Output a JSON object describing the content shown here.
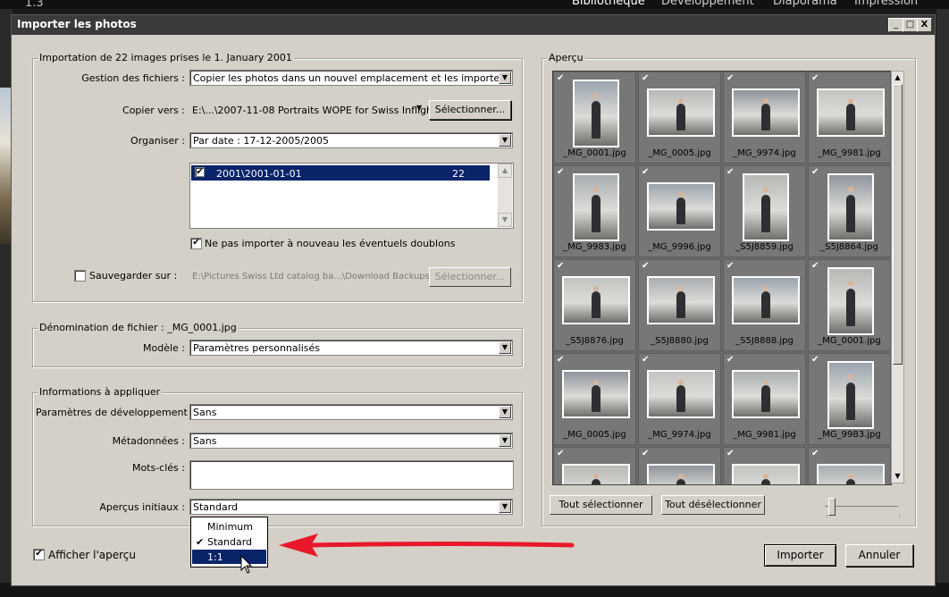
{
  "app": {
    "version": "1.3",
    "modules": [
      "Bibliothèque",
      "Développement",
      "Diaporama",
      "Impression"
    ]
  },
  "dialog": {
    "title": "Importer les photos",
    "controls": {
      "minimize": "_",
      "maximize": "□",
      "close": "X"
    },
    "import_section": {
      "legend": "Importation de 22 images prises le 1. January 2001",
      "file_handling_label": "Gestion des fichiers :",
      "file_handling_value": "Copier les photos dans un nouvel emplacement et les importer",
      "copy_to_label": "Copier vers :",
      "copy_to_value": "E:\\...\\2007-11-08 Portraits WOPE for Swiss Inflight",
      "select_button": "Sélectionner...",
      "organize_label": "Organiser :",
      "organize_value": "Par date : 17-12-2005/2005",
      "folders": [
        {
          "path": "2001\\2001-01-01",
          "count": "22",
          "checked": true
        }
      ],
      "skip_duplicates_label": "Ne pas importer à nouveau les éventuels doublons",
      "skip_duplicates_checked": true,
      "backup_label": "Sauvegarder sur :",
      "backup_checked": false,
      "backup_value": "E:\\Pictures Swiss Ltd catalog ba...\\Download Backups",
      "backup_select_button": "Sélectionner..."
    },
    "naming_section": {
      "legend": "Dénomination de fichier : _MG_0001.jpg",
      "template_label": "Modèle :",
      "template_value": "Paramètres personnalisés"
    },
    "apply_section": {
      "legend": "Informations à appliquer",
      "develop_label": "Paramètres de développement :",
      "develop_value": "Sans",
      "metadata_label": "Métadonnées :",
      "metadata_value": "Sans",
      "keywords_label": "Mots-clés :",
      "keywords_value": "",
      "previews_label": "Aperçus initiaux :",
      "previews_value": "Standard",
      "previews_options": [
        {
          "label": "Minimum",
          "checked": false,
          "highlighted": false
        },
        {
          "label": "Standard",
          "checked": true,
          "highlighted": false
        },
        {
          "label": "1:1",
          "checked": false,
          "highlighted": true
        }
      ]
    },
    "show_preview_label": "Afficher l'aperçu",
    "show_preview_checked": true,
    "preview": {
      "legend": "Aperçu",
      "thumbnails": [
        {
          "name": "_MG_0001.jpg",
          "orientation": "portrait"
        },
        {
          "name": "_MG_0005.jpg",
          "orientation": "landscape"
        },
        {
          "name": "_MG_9974.jpg",
          "orientation": "landscape"
        },
        {
          "name": "_MG_9981.jpg",
          "orientation": "landscape"
        },
        {
          "name": "_MG_9983.jpg",
          "orientation": "portrait"
        },
        {
          "name": "_MG_9996.jpg",
          "orientation": "landscape"
        },
        {
          "name": "_S5J8859.jpg",
          "orientation": "portrait"
        },
        {
          "name": "_S5J8864.jpg",
          "orientation": "portrait"
        },
        {
          "name": "_S5J8876.jpg",
          "orientation": "landscape"
        },
        {
          "name": "_S5J8880.jpg",
          "orientation": "landscape"
        },
        {
          "name": "_S5J8888.jpg",
          "orientation": "landscape"
        },
        {
          "name": "_MG_0001.jpg",
          "orientation": "portrait"
        },
        {
          "name": "_MG_0005.jpg",
          "orientation": "landscape"
        },
        {
          "name": "_MG_9974.jpg",
          "orientation": "landscape"
        },
        {
          "name": "_MG_9981.jpg",
          "orientation": "landscape"
        },
        {
          "name": "_MG_9983.jpg",
          "orientation": "portrait"
        },
        {
          "name": "",
          "orientation": "landscape"
        },
        {
          "name": "",
          "orientation": "landscape"
        },
        {
          "name": "",
          "orientation": "landscape"
        },
        {
          "name": "",
          "orientation": "landscape"
        }
      ],
      "select_all": "Tout sélectionner",
      "deselect_all": "Tout désélectionner",
      "thumb_size_level": 0.05
    },
    "import_button": "Importer",
    "cancel_button": "Annuler"
  },
  "colors": {
    "annotation_arrow": "#e8182a",
    "selection": "#0a246a"
  }
}
